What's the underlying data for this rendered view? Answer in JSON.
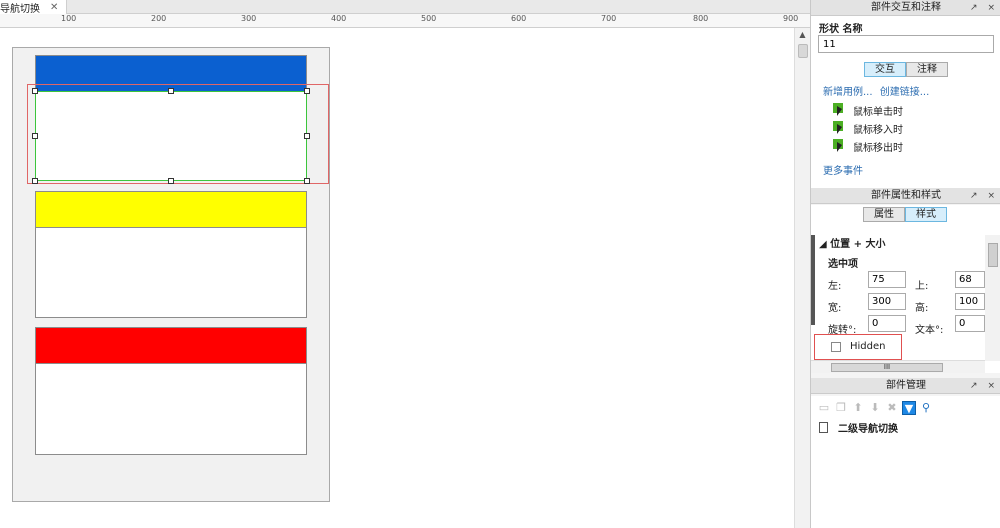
{
  "document_tab": {
    "label": "导航切换",
    "close_icon": "close-icon"
  },
  "ruler": {
    "ticks": [
      "100",
      "200",
      "300",
      "400",
      "500",
      "600",
      "700",
      "800",
      "900"
    ]
  },
  "canvas": {
    "colors": {
      "blue": "#0b60d0",
      "yellow": "#ffff00",
      "red": "#ff0000",
      "selection_red": "#e06666",
      "selection_green": "#3cc53c"
    }
  },
  "interaction_panel": {
    "title": "部件交互和注释",
    "shape_name_label": "形状 名称",
    "shape_name_value": "11",
    "tabs": [
      {
        "label": "交互",
        "active": true
      },
      {
        "label": "注释",
        "active": false
      }
    ],
    "add_case": "新增用例...",
    "create_link": "创建链接...",
    "events": [
      "鼠标单击时",
      "鼠标移入时",
      "鼠标移出时"
    ],
    "more_events": "更多事件"
  },
  "properties_panel": {
    "title": "部件属性和样式",
    "tabs": [
      {
        "label": "属性",
        "active": false
      },
      {
        "label": "样式",
        "active": true
      }
    ],
    "section_title": "◢ 位置 + 大小",
    "selected_label": "选中项",
    "fields": {
      "left_label": "左:",
      "left_value": "75",
      "top_label": "上:",
      "top_value": "68",
      "width_label": "宽:",
      "width_value": "300",
      "height_label": "高:",
      "height_value": "100",
      "rotate_label": "旋转°:",
      "rotate_value": "0",
      "text_rotate_label": "文本°:",
      "text_rotate_value": "0"
    },
    "hidden_label": "Hidden",
    "hidden_checked": false,
    "hscroll_grip": "III"
  },
  "manager_panel": {
    "title": "部件管理",
    "item_label": "二级导航切换"
  },
  "panel_header_icons": {
    "pin": "↗",
    "close": "×"
  }
}
